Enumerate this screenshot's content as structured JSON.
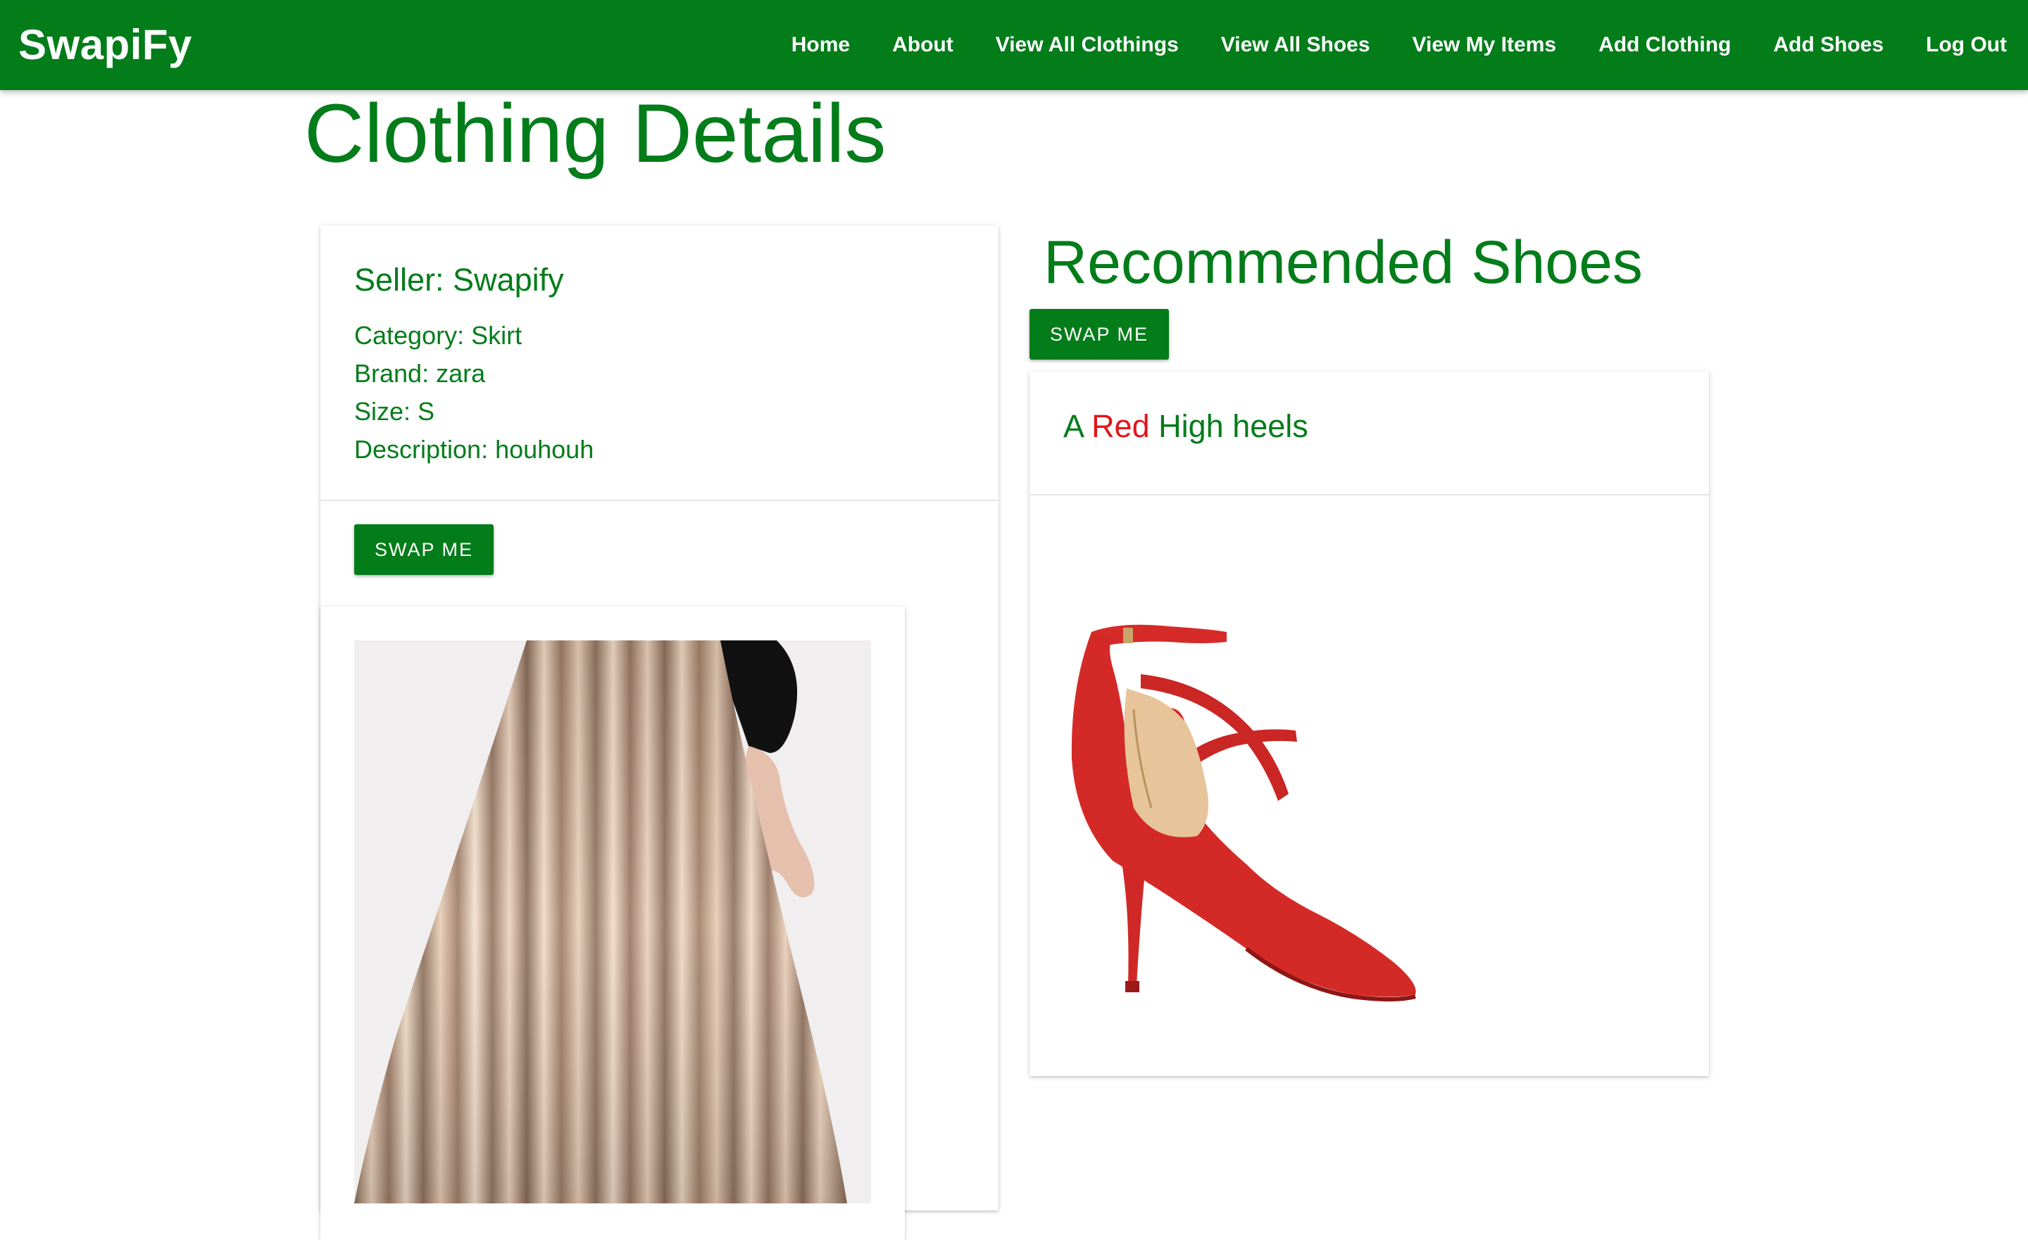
{
  "navbar": {
    "brand": "SwapiFy",
    "links": [
      "Home",
      "About",
      "View All Clothings",
      "View All Shoes",
      "View My Items",
      "Add Clothing",
      "Add Shoes",
      "Log Out"
    ]
  },
  "page": {
    "title": "Clothing Details"
  },
  "clothing": {
    "seller": "Seller: Swapify",
    "category": "Category: Skirt",
    "brand": "Brand: zara",
    "size": "Size: S",
    "description": "Description: houhouh",
    "swap_label": "SWAP ME"
  },
  "recommended": {
    "title": "Recommended Shoes",
    "swap_label": "SWAP ME",
    "item": {
      "prefix": "A",
      "color_word": "Red",
      "name": "High heels"
    }
  },
  "colors": {
    "brand_green": "#037c1a",
    "highlight_red": "#e2161a"
  }
}
